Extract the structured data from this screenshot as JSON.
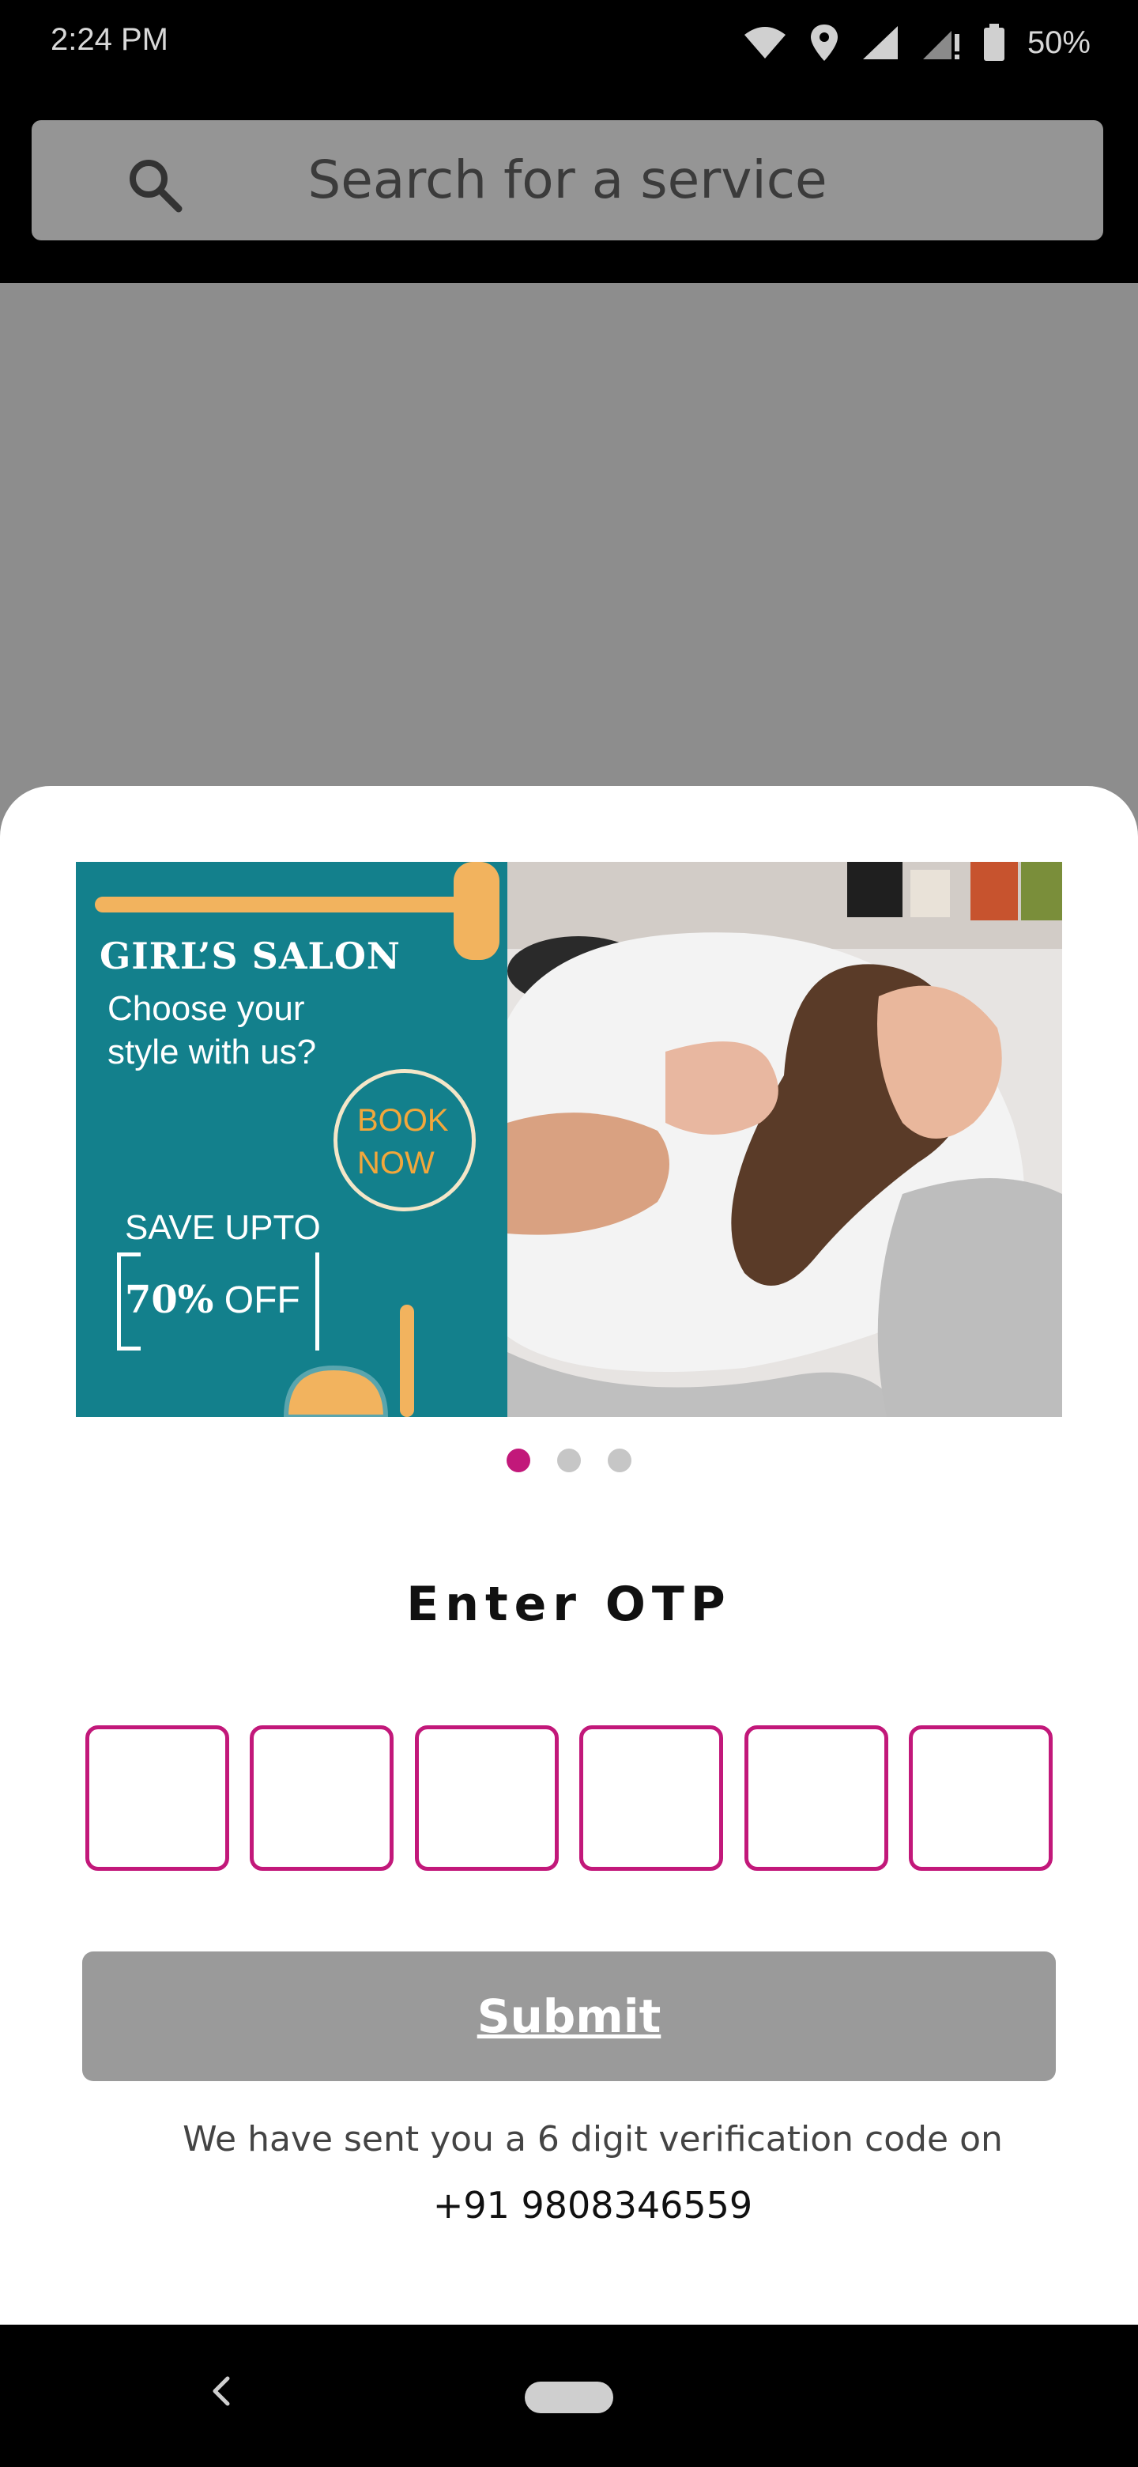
{
  "status_bar": {
    "time": "2:24 PM",
    "battery": "50%",
    "icons": [
      "wifi-icon",
      "location-icon",
      "signal-icon",
      "signal-alert-icon",
      "battery-icon"
    ]
  },
  "search": {
    "placeholder": "Search for a service",
    "icon": "search-icon"
  },
  "banner": {
    "title": "GIRL’S SALON",
    "subtitle": "Choose your style with us?",
    "cta": "BOOK NOW",
    "save_label": "SAVE UPTO",
    "offer_number": "70%",
    "offer_text": "OFF",
    "carousel_count": 3,
    "carousel_active": 0
  },
  "otp": {
    "title": "Enter OTP",
    "digits": [
      "",
      "",
      "",
      "",
      "",
      ""
    ]
  },
  "submit_label": "Submit",
  "verification": {
    "message": "We have sent you a 6 digit verification code on",
    "phone": "+91 9808346559"
  },
  "colors": {
    "accent": "#c2187a",
    "banner_teal": "#13808c",
    "banner_orange": "#f2a73b",
    "button_disabled": "#9a9a9a"
  },
  "nav": {
    "back_icon": "back-chevron-icon",
    "home_icon": "home-pill-icon"
  }
}
